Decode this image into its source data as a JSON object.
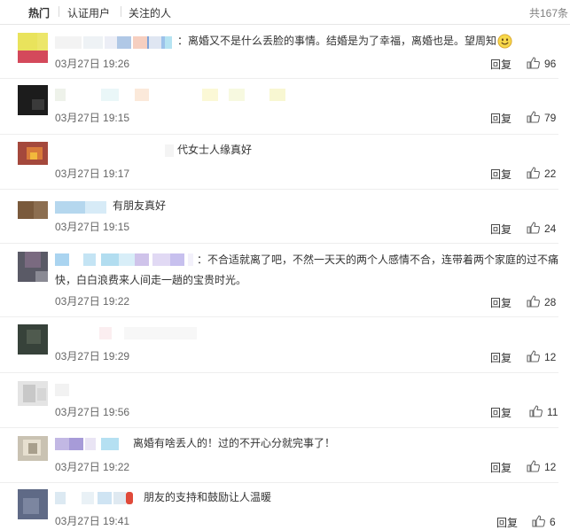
{
  "tabs": {
    "hot": "热门",
    "verified": "认证用户",
    "following": "关注的人"
  },
  "total": "共167条",
  "reply_label": "回复",
  "comments": [
    {
      "text": "：离婚又不是什么丢脸的事情。结婚是为了幸福，离婚也是。望周知",
      "time": "03月27日 19:26",
      "likes": "96"
    },
    {
      "text": "",
      "time": "03月27日 19:15",
      "likes": "79"
    },
    {
      "text": "代女士人缘真好",
      "time": "03月27日 19:17",
      "likes": "22"
    },
    {
      "text": "有朋友真好",
      "time": "03月27日 19:15",
      "likes": "24"
    },
    {
      "text_line1": "：不合适就离了吧，不然一天天的两个人感情不合，连带着两个家庭的过不痛",
      "text_line2": "快，白白浪费来人间走一趟的宝贵时光。",
      "time": "03月27日 19:22",
      "likes": "28"
    },
    {
      "text": "",
      "time": "03月27日 19:29",
      "likes": "12"
    },
    {
      "text": "",
      "time": "03月27日 19:56",
      "likes": "11"
    },
    {
      "text": "离婚有啥丢人的！过的不开心分就完事了！",
      "time": "03月27日 19:22",
      "likes": "12"
    },
    {
      "text": "朋友的支持和鼓励让人温暖",
      "time": "03月27日 19:41",
      "likes": "6"
    }
  ],
  "icons": {
    "like": "thumbs-up-icon",
    "emoji": "smiley-icon"
  },
  "colors": {
    "text": "#333333",
    "muted": "#808080",
    "divider": "#eeeeee",
    "like_icon": "#666666"
  }
}
